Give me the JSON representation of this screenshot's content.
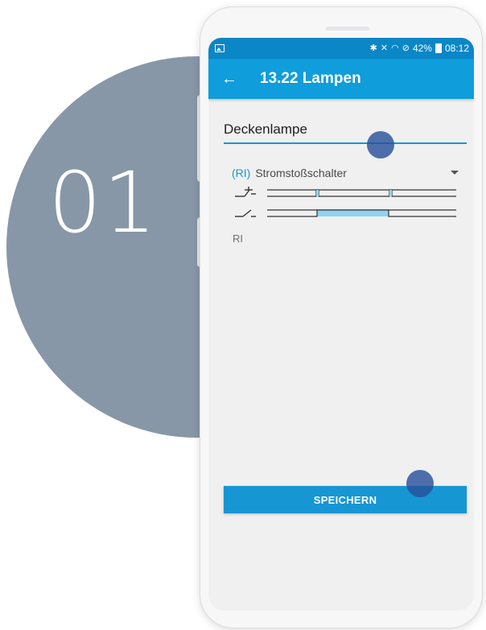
{
  "tutorial": {
    "step_number": "01"
  },
  "status_bar": {
    "battery": "42%",
    "time": "08:12"
  },
  "app_bar": {
    "title": "13.22 Lampen"
  },
  "form": {
    "name_value": "Deckenlampe",
    "type_code": "(RI)",
    "type_label": "Stromstoßschalter",
    "short_code": "RI"
  },
  "actions": {
    "save_label": "SPEICHERN"
  },
  "colors": {
    "accent": "#0f9ddb",
    "status_bar": "#0b86c6",
    "step_circle": "#8797a8",
    "touch_indicator": "#28509b",
    "diagram_fill": "#90d2f2"
  },
  "icons": {
    "back": "arrow-left-icon",
    "dropdown": "triangle-down-icon",
    "bluetooth": "bluetooth-icon",
    "wifi": "wifi-icon",
    "battery": "battery-icon"
  }
}
